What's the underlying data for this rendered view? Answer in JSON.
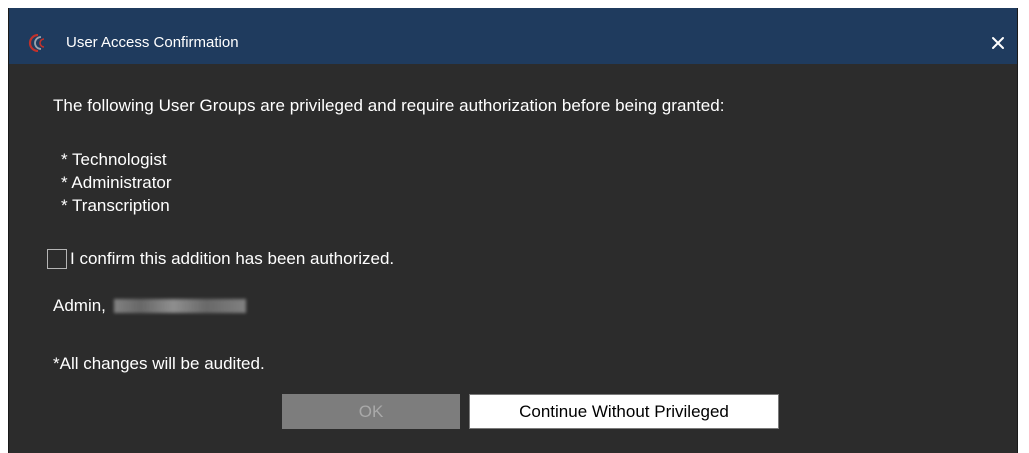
{
  "dialog": {
    "title": "User Access Confirmation",
    "close_label": "✕"
  },
  "message": {
    "intro": "The following User Groups are privileged and require authorization before being granted:",
    "groups": [
      "* Technologist",
      "* Administrator",
      "* Transcription"
    ]
  },
  "confirmation": {
    "label": "I confirm this addition has been authorized.",
    "checked": false
  },
  "admin": {
    "prefix": "Admin,"
  },
  "audit_note": "*All changes will be audited.",
  "buttons": {
    "ok_label": "OK",
    "ok_enabled": false,
    "continue_label": "Continue Without Privileged"
  },
  "colors": {
    "titlebar": "#1f3b5e",
    "background": "#2c2c2c",
    "text": "#ffffff",
    "button_disabled": "#7d7d7d",
    "icon_red": "#c0312b"
  },
  "icons": {
    "app": "app-logo-icon",
    "close": "close-icon"
  }
}
